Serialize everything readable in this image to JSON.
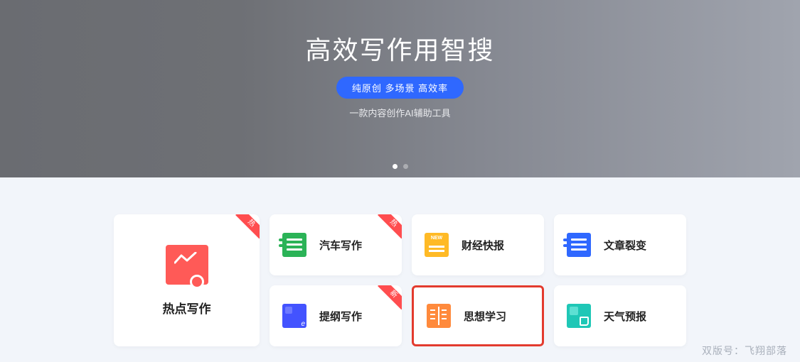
{
  "hero": {
    "title": "高效写作用智搜",
    "pill": "纯原创 多场景 高效率",
    "sub": "一款内容创作AI辅助工具"
  },
  "featured": {
    "label": "热点写作",
    "ribbon": "热"
  },
  "cards": [
    {
      "label": "汽车写作",
      "icon": "car-icon",
      "ribbon": "热"
    },
    {
      "label": "财经快报",
      "icon": "finance-icon",
      "ribbon": ""
    },
    {
      "label": "文章裂变",
      "icon": "split-icon",
      "ribbon": ""
    },
    {
      "label": "提纲写作",
      "icon": "outline-icon",
      "ribbon": "新"
    },
    {
      "label": "思想学习",
      "icon": "thought-icon",
      "ribbon": "",
      "selected": true
    },
    {
      "label": "天气预报",
      "icon": "weather-icon",
      "ribbon": ""
    }
  ],
  "watermark": "双版号：飞翔部落"
}
